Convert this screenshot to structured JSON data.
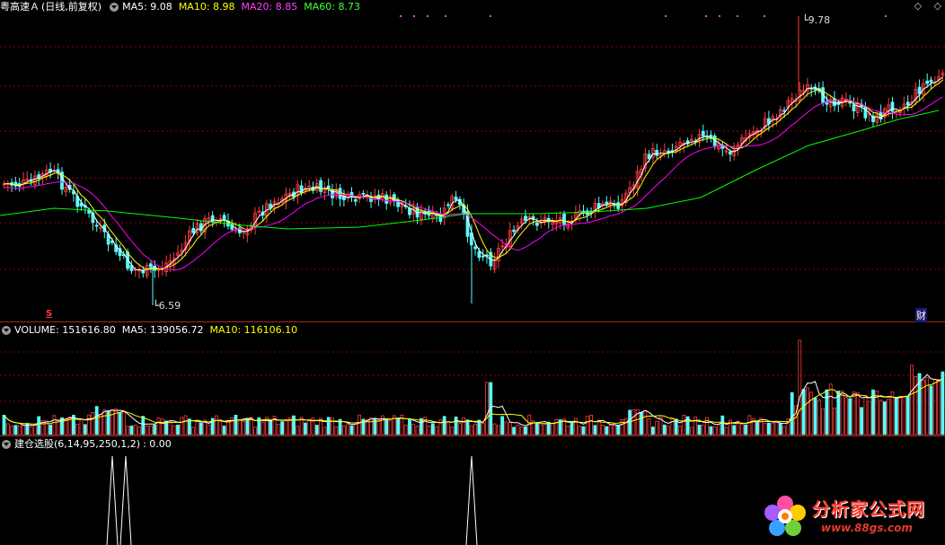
{
  "main_panel": {
    "stock_name": "粤高速Ａ",
    "period": "(日线,前复权)",
    "ma5": "MA5: 9.08",
    "ma10": "MA10: 8.98",
    "ma20": "MA20: 8.85",
    "ma60": "MA60: 8.73",
    "high_label": "9.78",
    "low_label": "6.59",
    "signal_marker": "S",
    "finance_marker": "财"
  },
  "volume_panel": {
    "volume": "VOLUME: 151616.80",
    "ma5": "MA5: 139056.72",
    "ma10": "MA10: 116106.10"
  },
  "indicator_panel": {
    "label": "建仓选股(6,14,95,250,1,2)",
    "value": ": 0.00"
  },
  "colors": {
    "up": "#ff3c3c",
    "down": "#54ffff",
    "ma5": "#ffffff",
    "ma10": "#ffff00",
    "ma20": "#ff00ff",
    "ma60": "#00ff00",
    "grid": "#8b0000"
  },
  "icons": [
    "collapse-toggle-icon",
    "diamond-icon",
    "bookmark-icon"
  ],
  "watermark": {
    "title": "分析家公式网",
    "url": "www.88gs.com"
  }
}
